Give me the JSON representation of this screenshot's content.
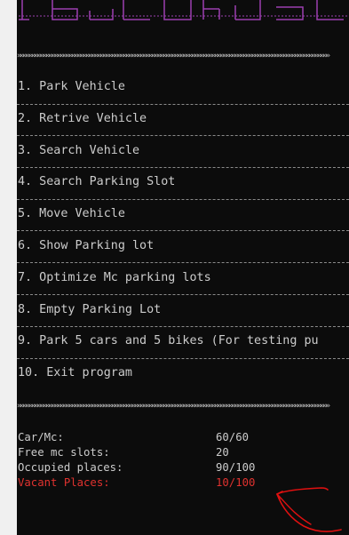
{
  "menu": {
    "items": [
      {
        "label": "1. Park Vehicle"
      },
      {
        "label": "2. Retrive Vehicle"
      },
      {
        "label": "3. Search Vehicle"
      },
      {
        "label": "4. Search Parking Slot"
      },
      {
        "label": "5. Move Vehicle"
      },
      {
        "label": "6. Show Parking lot"
      },
      {
        "label": "7. Optimize Mc parking lots"
      },
      {
        "label": "8. Empty Parking Lot"
      },
      {
        "label": "9. Park 5 cars and 5 bikes (For testing pu"
      },
      {
        "label": "10. Exit program"
      }
    ],
    "divider": "»»»»»»»»»»»»»»»»»»»»»»»»»»»»»»»»»»»»»»»»»»»»»»»»»»»»»»»»»»»»»»»»»»»»»»»»»»»»»»»»»»»»»»»»»»»»»»»»»»»»»»»»»»»»»"
  },
  "stats": [
    {
      "label": "Car/Mc:",
      "value": "60/60"
    },
    {
      "label": "Free mc slots:",
      "value": "20"
    },
    {
      "label": "Occupied places:",
      "value": "90/100"
    },
    {
      "label": "Vacant Places:",
      "value": "10/100"
    }
  ],
  "colors": {
    "terminal_bg": "#0c0c0c",
    "text": "#cccccc",
    "banner": "#9b3fb0",
    "vacant": "#e0322f",
    "annotation": "#e01010"
  }
}
